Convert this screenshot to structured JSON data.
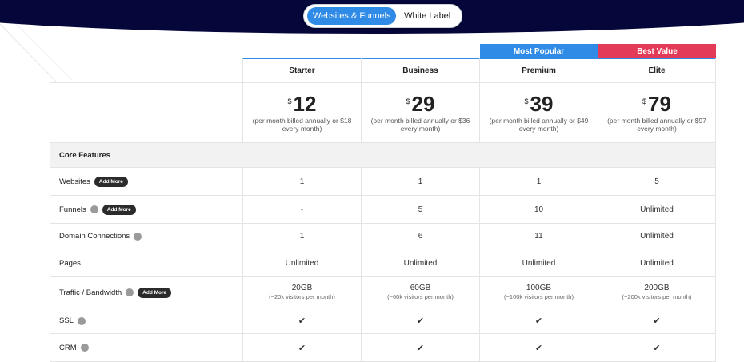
{
  "toggle": {
    "active": "Websites & Funnels",
    "inactive": "White Label"
  },
  "badges": {
    "popular": "Most Popular",
    "best": "Best Value"
  },
  "plans": [
    {
      "name": "Starter",
      "currency": "$",
      "price": "12",
      "note": "(per month billed annually or $18 every month)"
    },
    {
      "name": "Business",
      "currency": "$",
      "price": "29",
      "note": "(per month billed annually or $36 every month)"
    },
    {
      "name": "Premium",
      "currency": "$",
      "price": "39",
      "note": "(per month billed annually or $49 every month)"
    },
    {
      "name": "Elite",
      "currency": "$",
      "price": "79",
      "note": "(per month billed annually or $97 every month)"
    }
  ],
  "section": "Core Features",
  "add_more_label": "Add More",
  "check_symbol": "✔",
  "features": [
    {
      "label": "Websites",
      "info": false,
      "add_more": true,
      "values": [
        "1",
        "1",
        "1",
        "5"
      ]
    },
    {
      "label": "Funnels",
      "info": true,
      "add_more": true,
      "values": [
        "-",
        "5",
        "10",
        "Unlimited"
      ]
    },
    {
      "label": "Domain Connections",
      "info": true,
      "add_more": false,
      "values": [
        "1",
        "6",
        "11",
        "Unlimited"
      ]
    },
    {
      "label": "Pages",
      "info": false,
      "add_more": false,
      "values": [
        "Unlimited",
        "Unlimited",
        "Unlimited",
        "Unlimited"
      ]
    },
    {
      "label": "Traffic / Bandwidth",
      "info": true,
      "add_more": true,
      "values": [
        "20GB",
        "60GB",
        "100GB",
        "200GB"
      ],
      "subs": [
        "(~20k visitors per month)",
        "(~60k visitors per month)",
        "(~100k visitors per month)",
        "(~200k visitors per month)"
      ]
    },
    {
      "label": "SSL",
      "info": true,
      "add_more": false,
      "values": [
        "✔",
        "✔",
        "✔",
        "✔"
      ]
    },
    {
      "label": "CRM",
      "info": true,
      "add_more": false,
      "values": [
        "✔",
        "✔",
        "✔",
        "✔"
      ]
    }
  ],
  "colors": {
    "accent": "#2f8be6",
    "best_value": "#e33b57",
    "hero": "#05063a"
  }
}
